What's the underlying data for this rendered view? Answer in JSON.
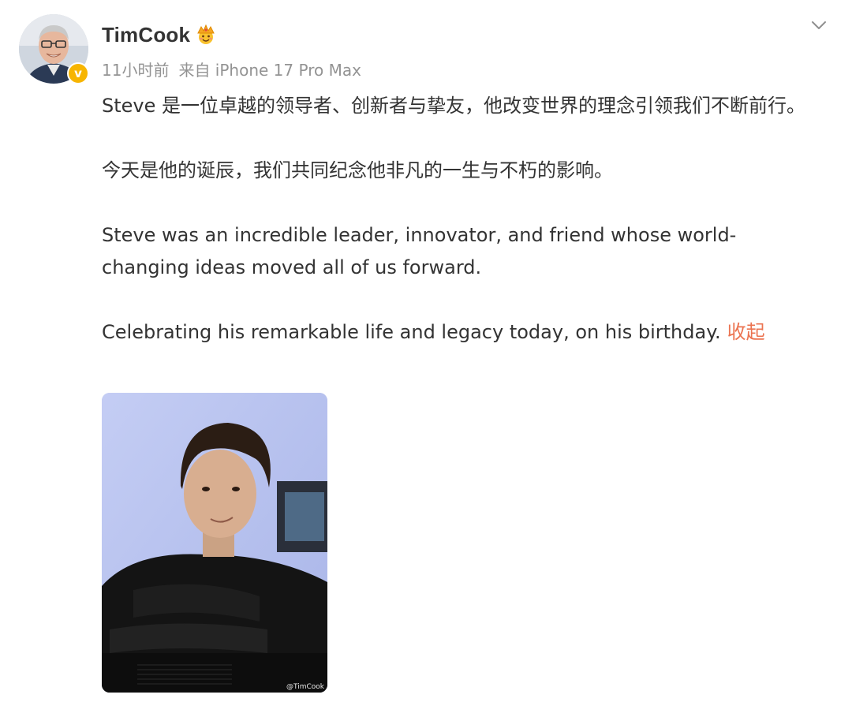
{
  "post": {
    "author": {
      "name": "TimCook",
      "avatar": "avatar-photo",
      "badge_icon": "verified-v-icon",
      "vip_icon": "crown-emoji-icon"
    },
    "meta": {
      "time": "11小时前",
      "source": "来自 iPhone 17 Pro Max"
    },
    "menu_icon": "chevron-down-icon",
    "body": {
      "paragraph_1": "Steve 是一位卓越的领导者、创新者与挚友，他改变世界的理念引领我们不断前行。",
      "paragraph_2": "今天是他的诞辰，我们共同纪念他非凡的一生与不朽的影响。",
      "paragraph_3": "Steve was an incredible leader, innovator, and friend whose world-changing ideas moved all of us forward.",
      "paragraph_4": "Celebrating his remarkable life and legacy today, on his birthday.",
      "collapse_label": "收起"
    },
    "image": {
      "watermark": "@TimCook"
    }
  },
  "colors": {
    "text": "#333333",
    "meta": "#939393",
    "link": "#eb7350",
    "badge": "#f7b500"
  }
}
